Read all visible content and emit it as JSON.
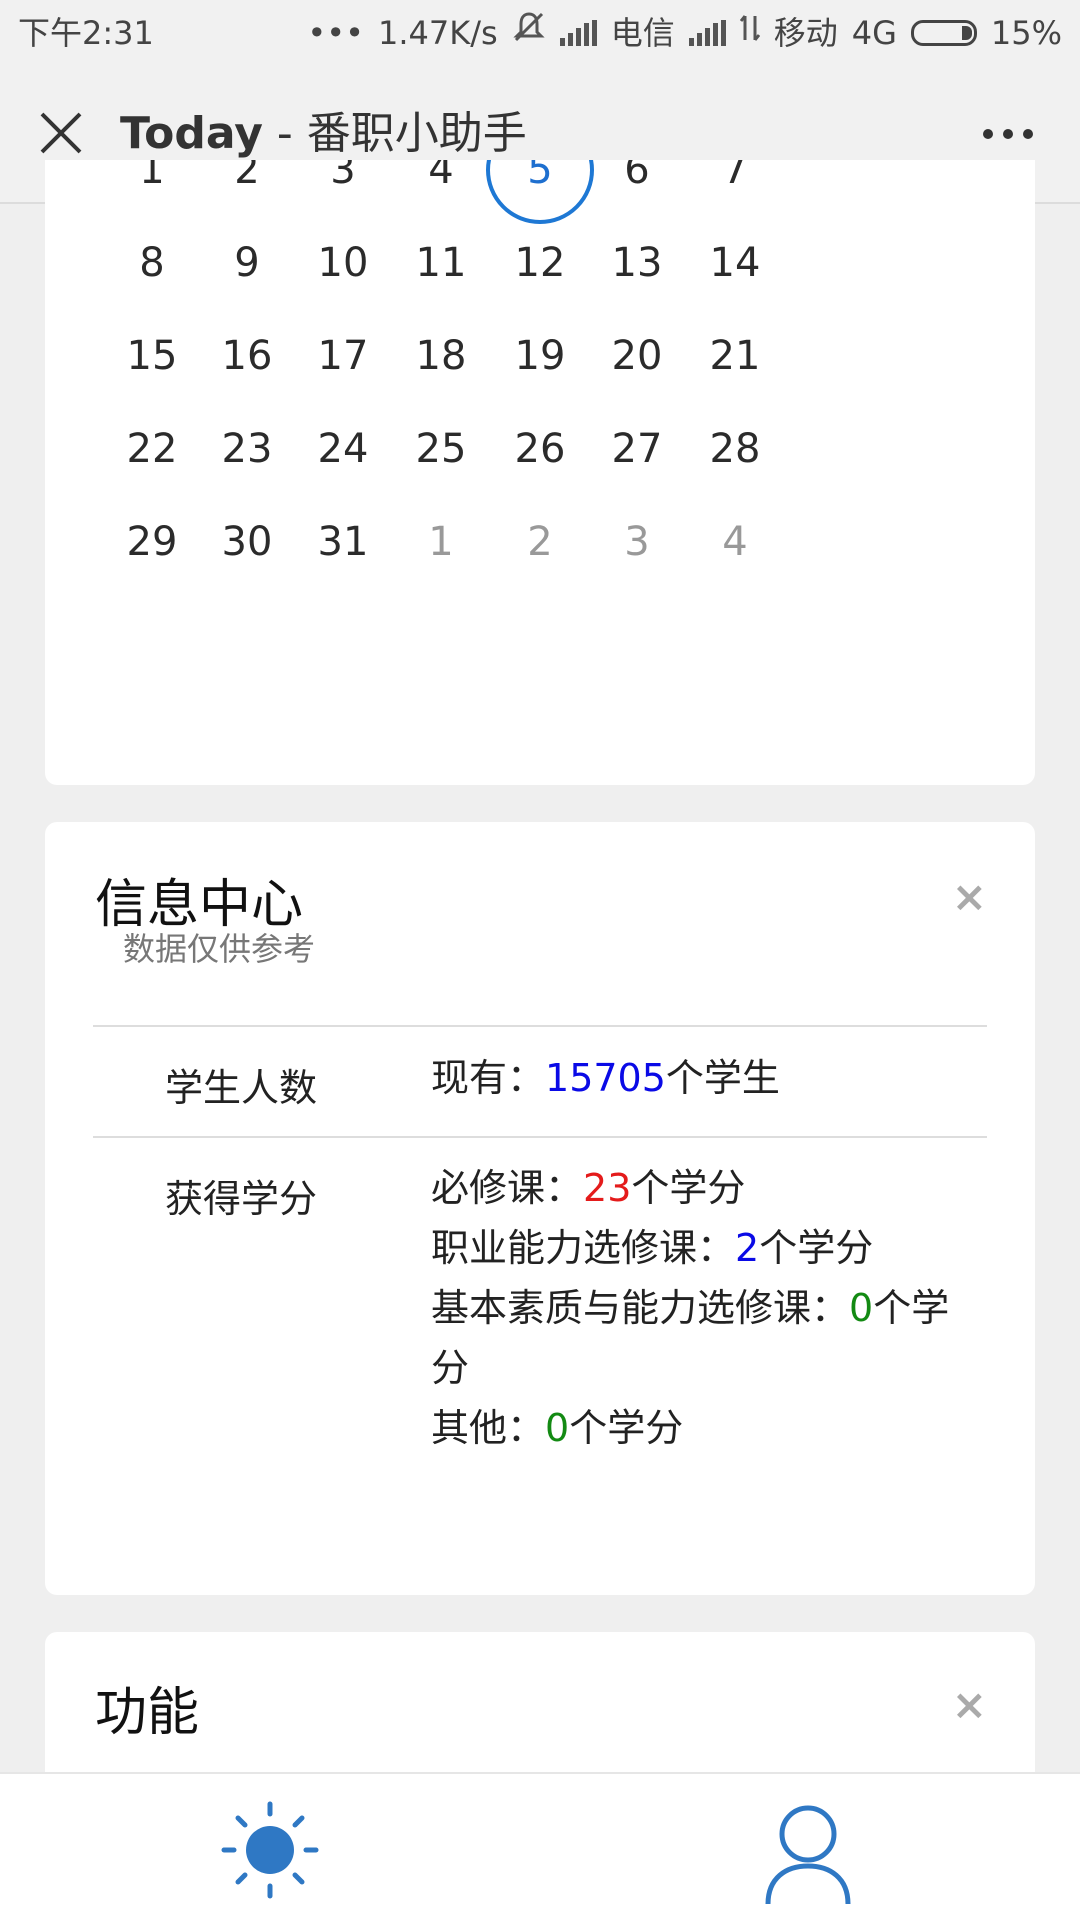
{
  "status_bar": {
    "time": "下午2:31",
    "dots": "•••",
    "speed": "1.47K/s",
    "carrier1": "电信",
    "carrier2": "移动",
    "network": "4G",
    "battery": "15%"
  },
  "header": {
    "title_bold": "Today",
    "title_rest": " - 番职小助手",
    "icons": {
      "close": "close-icon",
      "more": "more-icon"
    }
  },
  "calendar": {
    "today": "5",
    "weeks": [
      [
        {
          "d": "1"
        },
        {
          "d": "2"
        },
        {
          "d": "3"
        },
        {
          "d": "4"
        },
        {
          "d": "5",
          "today": true
        },
        {
          "d": "6"
        },
        {
          "d": "7"
        }
      ],
      [
        {
          "d": "8"
        },
        {
          "d": "9"
        },
        {
          "d": "10"
        },
        {
          "d": "11"
        },
        {
          "d": "12"
        },
        {
          "d": "13"
        },
        {
          "d": "14"
        }
      ],
      [
        {
          "d": "15"
        },
        {
          "d": "16"
        },
        {
          "d": "17"
        },
        {
          "d": "18"
        },
        {
          "d": "19"
        },
        {
          "d": "20"
        },
        {
          "d": "21"
        }
      ],
      [
        {
          "d": "22"
        },
        {
          "d": "23"
        },
        {
          "d": "24"
        },
        {
          "d": "25"
        },
        {
          "d": "26"
        },
        {
          "d": "27"
        },
        {
          "d": "28"
        }
      ],
      [
        {
          "d": "29"
        },
        {
          "d": "30"
        },
        {
          "d": "31"
        },
        {
          "d": "1",
          "other": true
        },
        {
          "d": "2",
          "other": true
        },
        {
          "d": "3",
          "other": true
        },
        {
          "d": "4",
          "other": true
        }
      ]
    ]
  },
  "info_center": {
    "title": "信息中心",
    "subtitle": "数据仅供参考",
    "close": "×",
    "students": {
      "label": "学生人数",
      "prefix": "现有：",
      "count": "15705",
      "suffix": "个学生"
    },
    "credits": {
      "label": "获得学分",
      "required_label": "必修课：",
      "required_value": "23",
      "career_label": "职业能力选修课：",
      "career_value": "2",
      "basic_label": "基本素质与能力选修课：",
      "basic_value": "0",
      "other_label": "其他：",
      "other_value": "0",
      "unit": "个学分"
    }
  },
  "functions": {
    "title": "功能",
    "close": "×"
  },
  "tab_bar": {
    "icons": {
      "home": "sun-icon",
      "me": "user-icon"
    },
    "colors": {
      "accent": "#2f78c4"
    }
  }
}
